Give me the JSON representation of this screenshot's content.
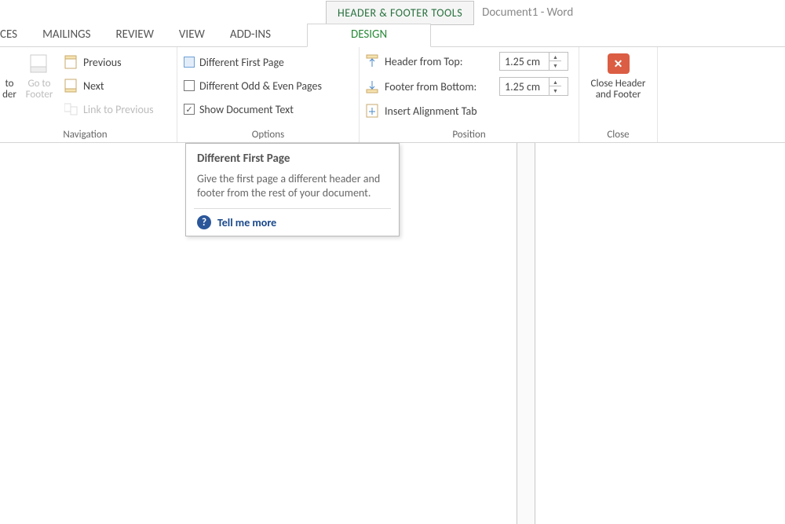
{
  "titlebar": {
    "tool_tab": "HEADER & FOOTER TOOLS",
    "doc_title": "Document1 - Word"
  },
  "tabs": {
    "partial": "CES",
    "items": [
      "MAILINGS",
      "REVIEW",
      "VIEW",
      "ADD-INS"
    ],
    "active": "DESIGN"
  },
  "navigation": {
    "group_label": "Navigation",
    "goto_header_lbl1": "to",
    "goto_header_lbl2": "der",
    "goto_footer_lbl1": "Go to",
    "goto_footer_lbl2": "Footer",
    "previous": "Previous",
    "next": "Next",
    "link_previous": "Link to Previous"
  },
  "options": {
    "group_label": "Options",
    "diff_first": "Different First Page",
    "diff_odd_even": "Different Odd & Even Pages",
    "show_doc_text": "Show Document Text"
  },
  "position": {
    "group_label": "Position",
    "header_top_label": "Header from Top:",
    "footer_bottom_label": "Footer from Bottom:",
    "header_value": "1.25 cm",
    "footer_value": "1.25 cm",
    "insert_align_tab": "Insert Alignment Tab"
  },
  "close": {
    "group_label": "Close",
    "label1": "Close Header",
    "label2": "and Footer"
  },
  "tooltip": {
    "title": "Different First Page",
    "body": "Give the first page a different header and footer from the rest of your document.",
    "tell_more": "Tell me more"
  }
}
